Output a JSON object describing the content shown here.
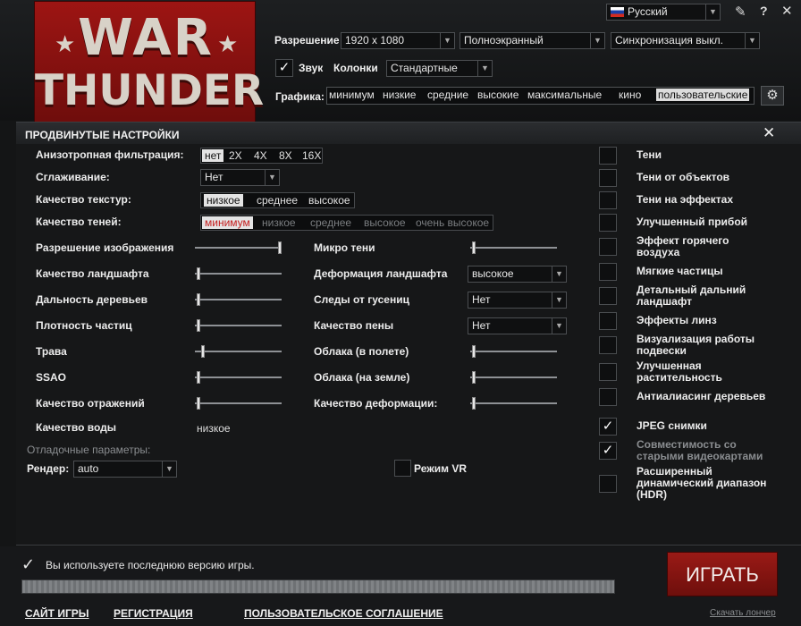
{
  "logo": {
    "line1": "WAR",
    "line2": "THUNDER"
  },
  "language": {
    "value": "Русский",
    "flag_colors": [
      "#ffffff",
      "#1c3fa8",
      "#d52b1e"
    ]
  },
  "window_controls": {
    "help": "?",
    "close": "✕"
  },
  "top": {
    "resolution_label": "Разрешение",
    "resolution_value": "1920 x 1080",
    "mode_value": "Полноэкранный",
    "vsync_value": "Синхронизация выкл.",
    "sound_label": "Звук",
    "sound_checked": "✓",
    "speakers_label": "Колонки",
    "speakers_value": "Стандартные",
    "graphics_label": "Графика:",
    "presets": [
      "минимум",
      "низкие",
      "средние",
      "высокие",
      "максимальные",
      "кино",
      "пользовательские"
    ],
    "preset_selected": "пользовательские"
  },
  "panel": {
    "title": "ПРОДВИНУТЫЕ НАСТРОЙКИ",
    "close": "✕",
    "aniso_label": "Анизотропная фильтрация:",
    "aniso_options": [
      "нет",
      "2X",
      "4X",
      "8X",
      "16X"
    ],
    "aa_label": "Сглаживание:",
    "aa_value": "Нет",
    "texture_label": "Качество текстур:",
    "texture_options": [
      "низкое",
      "среднее",
      "высокое"
    ],
    "shadow_label": "Качество теней:",
    "shadow_options": [
      "минимум",
      "низкое",
      "среднее",
      "высокое",
      "очень высокое"
    ],
    "sliders_left": [
      {
        "label": "Разрешение изображения",
        "level": 1.0
      },
      {
        "label": "Качество ландшафта",
        "level": 0.0
      },
      {
        "label": "Дальность деревьев",
        "level": 0.0
      },
      {
        "label": "Плотность частиц",
        "level": 0.0
      },
      {
        "label": "Трава",
        "level": 0.05
      },
      {
        "label": "SSAO",
        "level": 0.0
      },
      {
        "label": "Качество отражений",
        "level": 0.0
      }
    ],
    "water_label": "Качество воды",
    "water_value": "низкое",
    "mid_rows": [
      {
        "label": "Микро тени",
        "kind": "slider",
        "level": 0.0
      },
      {
        "label": "Деформация ландшафта",
        "kind": "dropdown",
        "value": "высокое"
      },
      {
        "label": "Следы от гусениц",
        "kind": "dropdown",
        "value": "Нет"
      },
      {
        "label": "Качество пены",
        "kind": "dropdown",
        "value": "Нет"
      },
      {
        "label": "Облака (в полете)",
        "kind": "slider",
        "level": 0.0
      },
      {
        "label": "Облака (на земле)",
        "kind": "slider",
        "level": 0.0
      },
      {
        "label": "Качество деформации:",
        "kind": "slider",
        "level": 0.0
      }
    ],
    "debug_label": "Отладочные параметры:",
    "render_label": "Рендер:",
    "render_value": "auto",
    "vr_label": "Режим VR",
    "right_options": [
      {
        "label": "Тени",
        "checked": false
      },
      {
        "label": "Тени от объектов",
        "checked": false
      },
      {
        "label": "Тени на эффектах",
        "checked": false
      },
      {
        "label": "Улучшенный прибой",
        "checked": false
      },
      {
        "label": "Эффект горячего воздуха",
        "checked": false
      },
      {
        "label": "Мягкие частицы",
        "checked": false
      },
      {
        "label": "Детальный дальний ландшафт",
        "checked": false
      },
      {
        "label": "Эффекты линз",
        "checked": false
      },
      {
        "label": "Визуализация работы подвески",
        "checked": false
      },
      {
        "label": "Улучшенная растительность",
        "checked": false
      },
      {
        "label": "Антиалиасинг деревьев",
        "checked": false
      },
      {
        "label": "JPEG снимки",
        "checked": true
      },
      {
        "label": "Совместимость со старыми видеокартами",
        "checked": true,
        "disabled": true
      },
      {
        "label": "Расширенный динамический диапазон (HDR)",
        "checked": false
      }
    ]
  },
  "status": {
    "check": "✓",
    "text": "Вы используете последнюю версию игры.",
    "progress": 1.0
  },
  "play_label": "ИГРАТЬ",
  "footer": {
    "site": "САЙТ ИГРЫ",
    "register": "РЕГИСТРАЦИЯ",
    "agreement": "ПОЛЬЗОВАТЕЛЬСКОЕ СОГЛАШЕНИЕ",
    "download": "Скачать лончер"
  }
}
